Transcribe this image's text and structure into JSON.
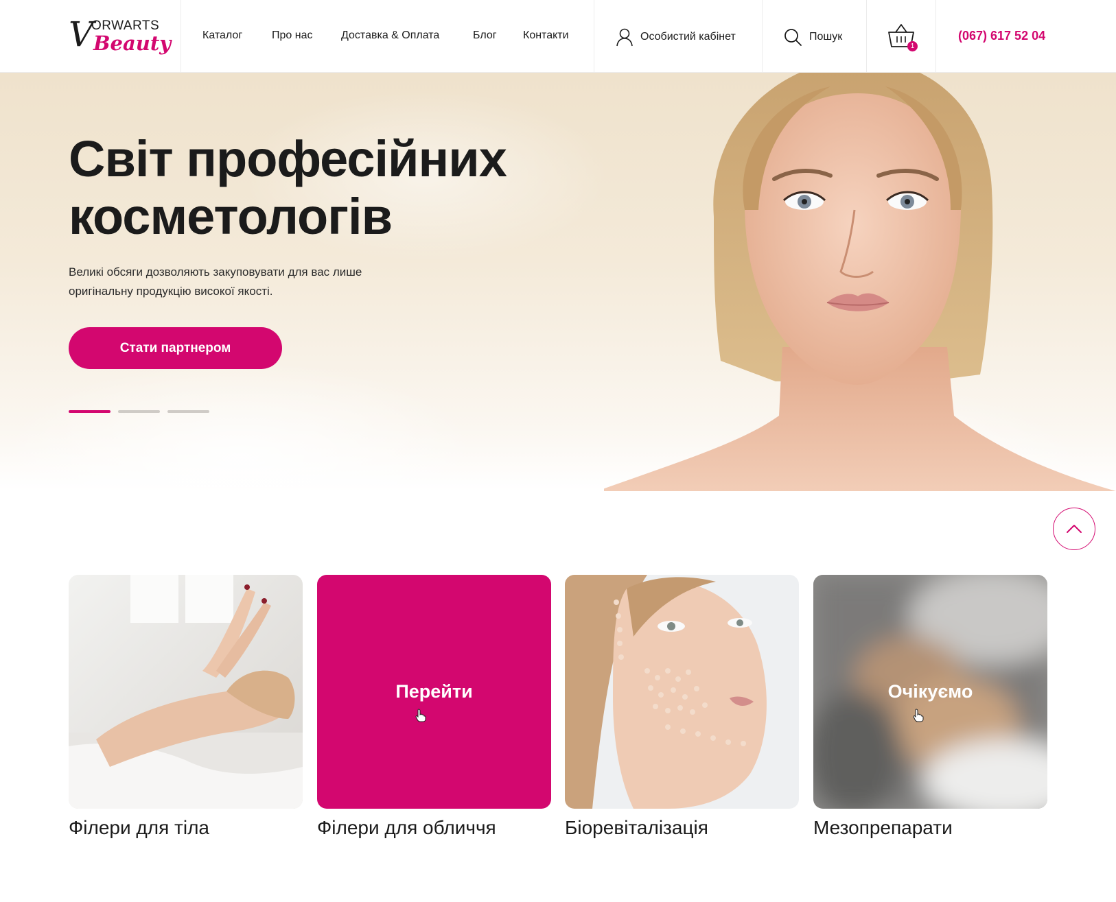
{
  "brand": {
    "logo_letter": "V",
    "logo_top": "ORWARTS",
    "logo_bottom": "Beauty",
    "accent_color": "#d3076f"
  },
  "nav": {
    "items": [
      {
        "label": "Каталог"
      },
      {
        "label": "Про нас"
      },
      {
        "label": "Доставка & Оплата"
      },
      {
        "label": "Блог"
      },
      {
        "label": "Контакти"
      }
    ],
    "account_label": "Особистий кабінет",
    "account_icon": "user-icon",
    "search_label": "Пошук",
    "search_icon": "search-icon",
    "cart_icon": "basket-icon",
    "cart_count": "1",
    "phone": "(067) 617 52 04"
  },
  "hero": {
    "title_line1": "Світ професійних",
    "title_line2": "косметологів",
    "subtitle_line1": "Великі обсяги дозволяють закуповувати для вас лише",
    "subtitle_line2": "оригінальну продукцію високої якості.",
    "cta_label": "Стати партнером",
    "slides_total": 3,
    "active_slide": 1
  },
  "scroll_top_icon": "chevron-up-icon",
  "categories": [
    {
      "title": "Філери для тіла",
      "overlay": ""
    },
    {
      "title": "Філери для обличчя",
      "overlay": "Перейти"
    },
    {
      "title": "Біоревіталізація",
      "overlay": ""
    },
    {
      "title": "Мезопрепарати",
      "overlay": "Очікуємо"
    }
  ]
}
